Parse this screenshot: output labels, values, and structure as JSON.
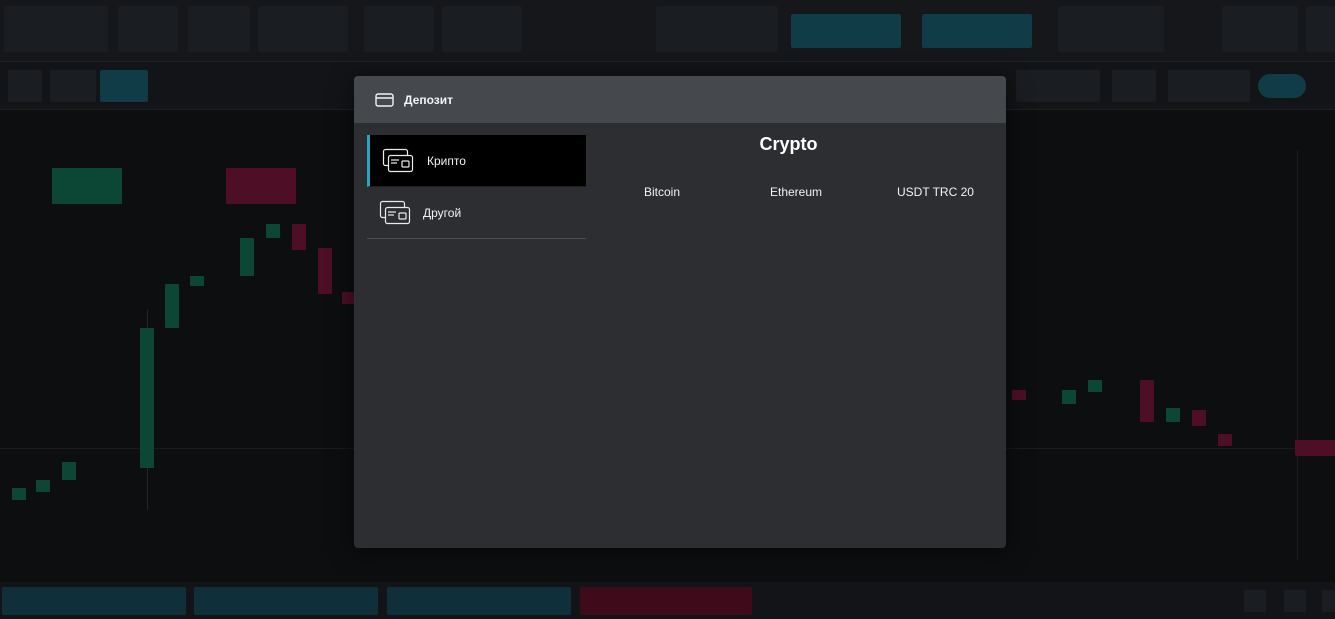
{
  "modal": {
    "title": "Депозит",
    "icon": "credit-card-icon"
  },
  "methods": [
    {
      "label": "Крипто",
      "icon": "cards-icon",
      "active": true
    },
    {
      "label": "Другой",
      "icon": "cards-icon",
      "active": false
    }
  ],
  "content": {
    "title": "Crypto",
    "options": [
      "Bitcoin",
      "Ethereum",
      "USDT TRC 20"
    ]
  },
  "colors": {
    "accent": "#2aa3bd",
    "modal_bg": "#2c2e31",
    "header_bg": "#45484d",
    "active_bg": "#000000"
  }
}
